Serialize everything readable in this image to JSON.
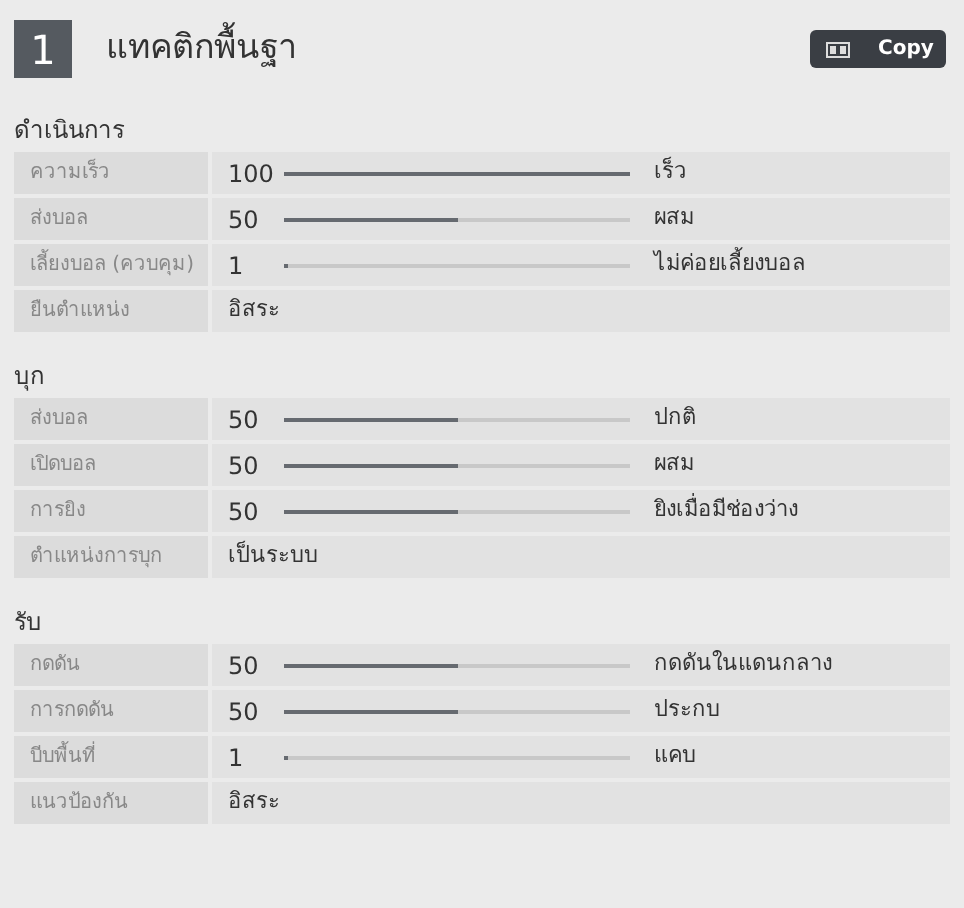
{
  "header": {
    "number": "1",
    "title": "แทคติกพื้นฐา",
    "copy_button": "Copy"
  },
  "sections": [
    {
      "title": "ดำเนินการ",
      "rows": [
        {
          "kind": "slider",
          "label": "ความเร็ว",
          "value": "100",
          "level": 1,
          "reading": "เร็ว"
        },
        {
          "kind": "slider",
          "label": "ส่งบอล",
          "value": "50",
          "level": 0.5,
          "reading": "ผสม"
        },
        {
          "kind": "slider",
          "label": "เลี้ยงบอล (ควบคุม)",
          "value": "1",
          "level": 0.01,
          "reading": "ไม่ค่อยเลี้ยงบอล"
        },
        {
          "kind": "text",
          "label": "ยืนตำแหน่ง",
          "value": "อิสระ"
        }
      ]
    },
    {
      "title": "บุก",
      "rows": [
        {
          "kind": "slider",
          "label": "ส่งบอล",
          "value": "50",
          "level": 0.5,
          "reading": "ปกติ"
        },
        {
          "kind": "slider",
          "label": "เปิดบอล",
          "value": "50",
          "level": 0.5,
          "reading": "ผสม"
        },
        {
          "kind": "slider",
          "label": "การยิง",
          "value": "50",
          "level": 0.5,
          "reading": "ยิงเมื่อมีช่องว่าง"
        },
        {
          "kind": "text",
          "label": "ตำแหน่งการบุก",
          "value": "เป็นระบบ"
        }
      ]
    },
    {
      "title": "รับ",
      "rows": [
        {
          "kind": "slider",
          "label": "กดดัน",
          "value": "50",
          "level": 0.5,
          "reading": "กดดันในแดนกลาง"
        },
        {
          "kind": "slider",
          "label": "การกดดัน",
          "value": "50",
          "level": 0.5,
          "reading": "ประกบ"
        },
        {
          "kind": "slider",
          "label": "บีบพื้นที่",
          "value": "1",
          "level": 0.01,
          "reading": "แคบ"
        },
        {
          "kind": "text",
          "label": "แนวป้องกัน",
          "value": "อิสระ"
        }
      ]
    }
  ]
}
